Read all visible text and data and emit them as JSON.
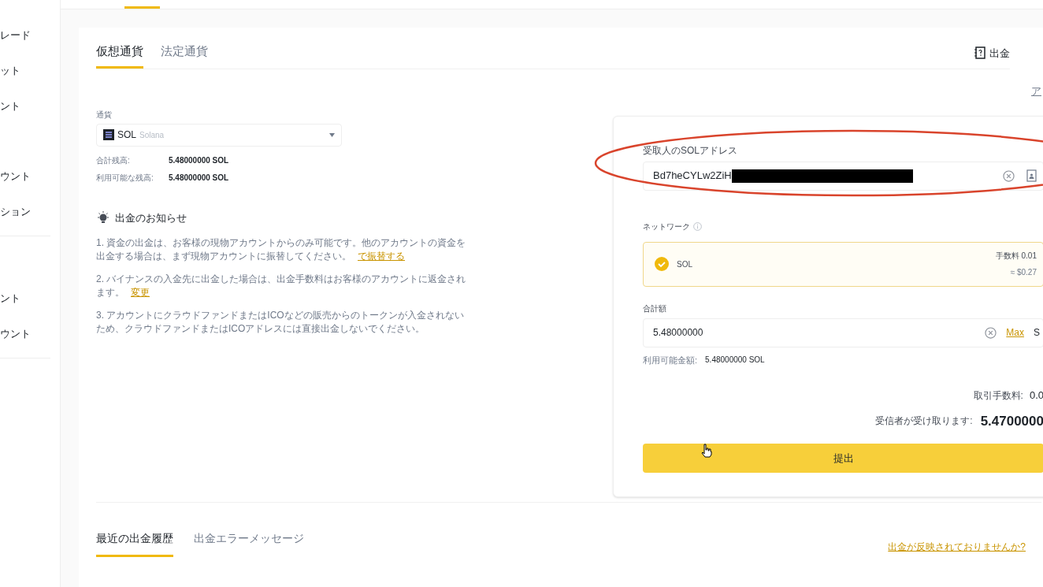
{
  "sidebar": {
    "groups": [
      {
        "items": [
          {
            "label": "レード"
          },
          {
            "label": "ット"
          },
          {
            "label": "ント"
          },
          {
            "label": "ウント"
          },
          {
            "label": "ション"
          }
        ]
      },
      {
        "items": [
          {
            "label": "ント"
          },
          {
            "label": "ウント"
          }
        ]
      }
    ]
  },
  "tabs": [
    {
      "label": "仮想通貨",
      "selected": true
    },
    {
      "label": "法定通貨",
      "selected": false
    }
  ],
  "help_link": "出金",
  "top_right_link": "ア",
  "currency": {
    "label": "通貨",
    "symbol": "SOL",
    "name": "Solana"
  },
  "balances": [
    {
      "label": "合計残高:",
      "value": "5.48000000 SOL"
    },
    {
      "label": "利用可能な残高:",
      "value": "5.48000000 SOL"
    }
  ],
  "notice": {
    "title": "出金のお知らせ",
    "items": [
      {
        "text": "1. 資金の出金は、お客様の現物アカウントからのみ可能です。他のアカウントの資金を出金する場合は、まず現物アカウントに振替してください。",
        "link": "で振替する"
      },
      {
        "text": "2. バイナンスの入金先に出金した場合は、出金手数料はお客様のアカウントに返金されます。",
        "link": "変更"
      },
      {
        "text": "3. アカウントにクラウドファンドまたはICOなどの販売からのトークンが入金されないため、クラウドファンドまたはICOアドレスには直接出金しないでください。"
      }
    ]
  },
  "address": {
    "label": "受取人のSOLアドレス",
    "value": "Bd7heCYLw2ZiH",
    "redacted": true,
    "circled": true
  },
  "network": {
    "label": "ネットワーク",
    "options": [
      {
        "name": "SOL",
        "selected": true,
        "fee": "手数料 0.01",
        "fee_usd": "≈ $0.27"
      }
    ]
  },
  "amount": {
    "label": "合計額",
    "value": "5.48000000",
    "max": "Max",
    "unit": "S",
    "available_label": "利用可能金額:",
    "available_value": "5.48000000 SOL"
  },
  "fee": {
    "label": "取引手数料:",
    "value": "0.0"
  },
  "receive": {
    "label": "受信者が受け取ります:",
    "value": "5.4700000"
  },
  "submit": "提出",
  "history_tabs": [
    {
      "label": "最近の出金履歴",
      "selected": true
    },
    {
      "label": "出金エラーメッセージ",
      "selected": false
    }
  ],
  "history_link": "出金が反映されておりませんか?"
}
